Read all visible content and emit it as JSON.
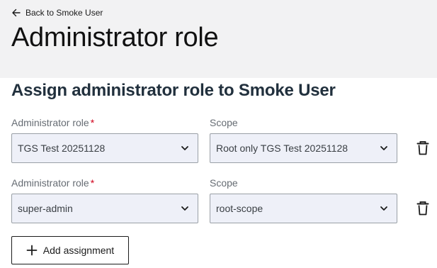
{
  "header": {
    "back_label": "Back to Smoke User",
    "title": "Administrator role"
  },
  "section": {
    "title": "Assign administrator role to Smoke User"
  },
  "assignments": [
    {
      "role_label": "Administrator role",
      "role_required_mark": "*",
      "role_value": "TGS Test 20251128",
      "scope_label": "Scope",
      "scope_value": "Root only TGS Test 20251128"
    },
    {
      "role_label": "Administrator role",
      "role_required_mark": "*",
      "role_value": "super-admin",
      "scope_label": "Scope",
      "scope_value": "root-scope"
    }
  ],
  "add_button": {
    "label": "Add assignment"
  },
  "icons": {
    "back": "arrow-left-icon",
    "dropdown": "chevron-down-icon",
    "delete": "trash-icon",
    "add": "plus-icon"
  },
  "colors": {
    "header_bg": "#f2f2f3",
    "select_bg": "#eef0f8",
    "required": "#d0021b",
    "section_title": "#21303d"
  }
}
